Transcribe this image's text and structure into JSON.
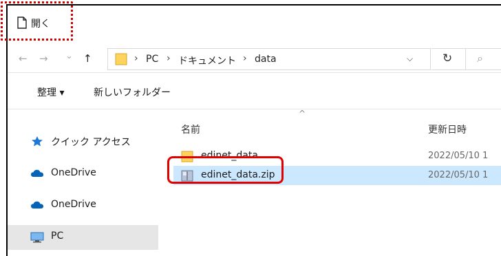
{
  "window": {
    "title": "開く"
  },
  "nav": {
    "back_glyph": "←",
    "forward_glyph": "→",
    "recent_glyph": "⌄",
    "up_glyph": "↑",
    "breadcrumbs": [
      "PC",
      "ドキュメント",
      "data"
    ],
    "separator": "›",
    "dropdown_glyph": "⌵",
    "refresh_glyph": "↻",
    "search_glyph": "⌕"
  },
  "toolbar": {
    "organize_label": "整理 ▾",
    "new_folder_label": "新しいフォルダー"
  },
  "sidebar": {
    "items": [
      {
        "label": "クイック アクセス",
        "icon": "star-icon"
      },
      {
        "label": "OneDrive",
        "icon": "cloud-icon"
      },
      {
        "label": "OneDrive",
        "icon": "cloud-icon"
      },
      {
        "label": "PC",
        "icon": "pc-icon",
        "selected": true
      }
    ]
  },
  "content": {
    "columns": {
      "name": "名前",
      "modified": "更新日時",
      "sort_glyph": "^"
    },
    "files": [
      {
        "name": "edinet_data",
        "modified": "2022/05/10 1",
        "icon": "folder-icon"
      },
      {
        "name": "edinet_data.zip",
        "modified": "2022/05/10 1",
        "icon": "zip-icon",
        "selected": true
      }
    ]
  },
  "colors": {
    "accent_selection": "#cce8ff",
    "folder": "#ffd45e",
    "highlight_annotation": "#e00000",
    "onedrive": "#0364b8"
  }
}
